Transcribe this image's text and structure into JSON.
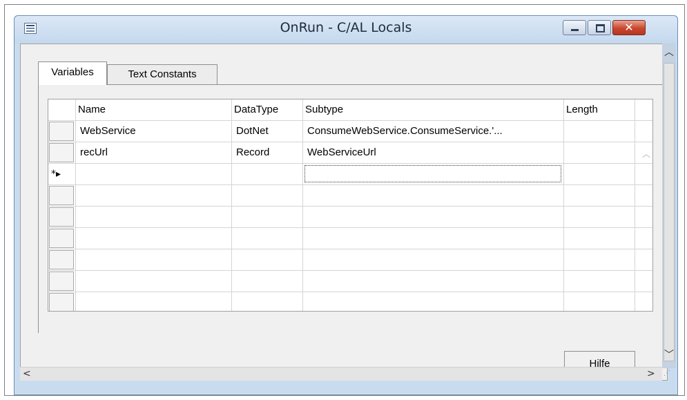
{
  "window": {
    "title": "OnRun - C/AL Locals",
    "close_symbol": "✕"
  },
  "tabs": [
    {
      "label": "Variables",
      "active": true
    },
    {
      "label": "Text Constants",
      "active": false
    }
  ],
  "grid": {
    "columns": [
      "Name",
      "DataType",
      "Subtype",
      "Length"
    ],
    "rows": [
      {
        "name": "WebService",
        "datatype": "DotNet",
        "subtype": "ConsumeWebService.ConsumeService.'...",
        "length": ""
      },
      {
        "name": "recUrl",
        "datatype": "Record",
        "subtype": "WebServiceUrl",
        "length": ""
      }
    ],
    "new_row_marker": "*▸"
  },
  "buttons": {
    "help_label": "Hilfe"
  },
  "icons": {
    "window_icon": "table-icon",
    "minimize": "minimize-icon",
    "maximize": "maximize-icon",
    "close": "close-icon"
  }
}
